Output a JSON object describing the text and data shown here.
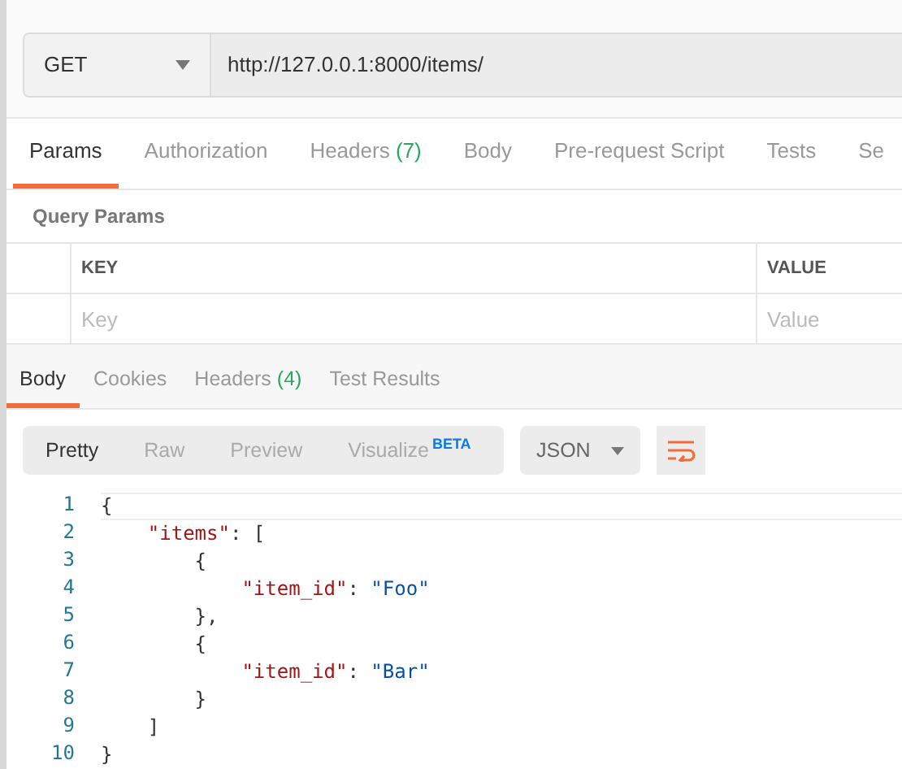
{
  "request": {
    "method": "GET",
    "url": "http://127.0.0.1:8000/items/"
  },
  "request_tabs": [
    {
      "label": "Params",
      "selected": true
    },
    {
      "label": "Authorization",
      "selected": false
    },
    {
      "label": "Headers",
      "count": "(7)",
      "selected": false
    },
    {
      "label": "Body",
      "selected": false
    },
    {
      "label": "Pre-request Script",
      "selected": false
    },
    {
      "label": "Tests",
      "selected": false
    },
    {
      "label": "Se",
      "selected": false
    }
  ],
  "query_params": {
    "title": "Query Params",
    "columns": [
      "KEY",
      "VALUE"
    ],
    "placeholders": [
      "Key",
      "Value"
    ]
  },
  "response_tabs": [
    {
      "label": "Body",
      "selected": true
    },
    {
      "label": "Cookies",
      "selected": false
    },
    {
      "label": "Headers",
      "count": "(4)",
      "selected": false
    },
    {
      "label": "Test Results",
      "selected": false
    }
  ],
  "view_modes": [
    {
      "label": "Pretty",
      "selected": true
    },
    {
      "label": "Raw",
      "selected": false
    },
    {
      "label": "Preview",
      "selected": false
    },
    {
      "label": "Visualize",
      "badge": "BETA",
      "selected": false
    }
  ],
  "format": "JSON",
  "code_lines": [
    {
      "number": "1",
      "tokens": [
        {
          "kind": "punct",
          "text": "{"
        }
      ]
    },
    {
      "number": "2",
      "tokens": [
        {
          "kind": "key",
          "text": "    \"items\""
        },
        {
          "kind": "punct",
          "text": ": ["
        }
      ]
    },
    {
      "number": "3",
      "tokens": [
        {
          "kind": "punct",
          "text": "        {"
        }
      ]
    },
    {
      "number": "4",
      "tokens": [
        {
          "kind": "key",
          "text": "            \"item_id\""
        },
        {
          "kind": "punct",
          "text": ": "
        },
        {
          "kind": "string",
          "text": "\"Foo\""
        }
      ]
    },
    {
      "number": "5",
      "tokens": [
        {
          "kind": "punct",
          "text": "        },"
        }
      ]
    },
    {
      "number": "6",
      "tokens": [
        {
          "kind": "punct",
          "text": "        {"
        }
      ]
    },
    {
      "number": "7",
      "tokens": [
        {
          "kind": "key",
          "text": "            \"item_id\""
        },
        {
          "kind": "punct",
          "text": ": "
        },
        {
          "kind": "string",
          "text": "\"Bar\""
        }
      ]
    },
    {
      "number": "8",
      "tokens": [
        {
          "kind": "punct",
          "text": "        }"
        }
      ]
    },
    {
      "number": "9",
      "tokens": [
        {
          "kind": "punct",
          "text": "    ]"
        }
      ]
    },
    {
      "number": "10",
      "tokens": [
        {
          "kind": "punct",
          "text": "}"
        }
      ]
    }
  ]
}
